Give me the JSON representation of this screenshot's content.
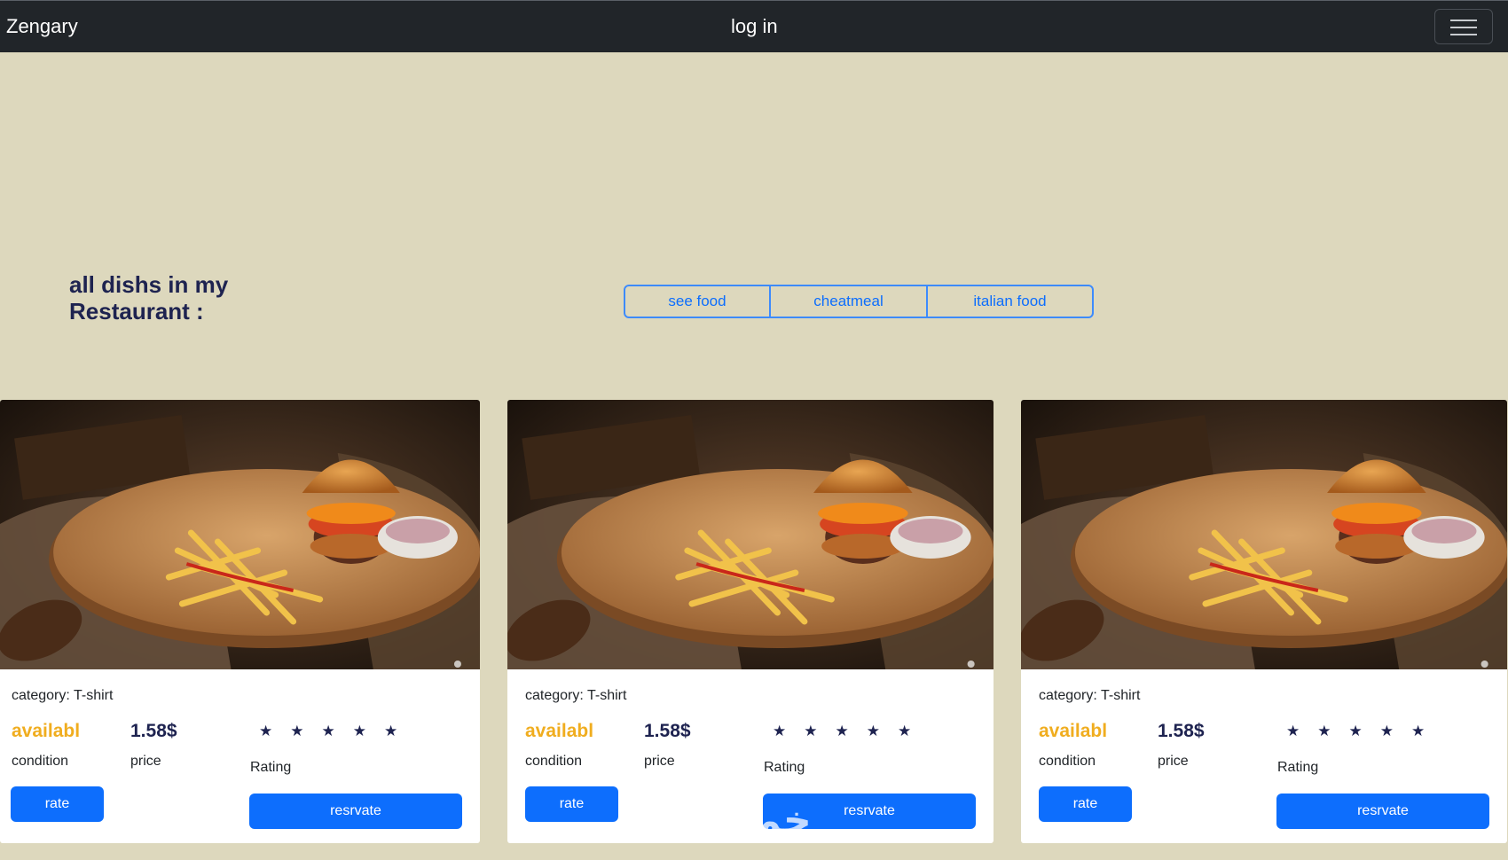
{
  "navbar": {
    "brand": "Zengary",
    "login": "log in",
    "menu_icon": "hamburger-icon"
  },
  "heading": "all dishs in my Restaurant :",
  "filters": [
    "see food",
    "cheatmeal",
    "italian food"
  ],
  "cards": [
    {
      "image": "burger-and-fries-photo",
      "category": "category: T-shirt",
      "availability": "availabl",
      "condition_label": "condition",
      "price": "1.58$",
      "price_label": "price",
      "stars": 5,
      "rating_label": "Rating",
      "rate_label": "rate",
      "reserve_label": "resrvate"
    },
    {
      "image": "burger-and-fries-photo",
      "category": "category: T-shirt",
      "availability": "availabl",
      "condition_label": "condition",
      "price": "1.58$",
      "price_label": "price",
      "stars": 5,
      "rating_label": "Rating",
      "rate_label": "rate",
      "reserve_label": "resrvate"
    },
    {
      "image": "burger-and-fries-photo",
      "category": "category: T-shirt",
      "availability": "availabl",
      "condition_label": "condition",
      "price": "1.58$",
      "price_label": "price",
      "stars": 5,
      "rating_label": "Rating",
      "rate_label": "rate",
      "reserve_label": "resrvate"
    }
  ],
  "watermark": "خمسات",
  "colors": {
    "background": "#ddd8bd",
    "navbar": "#212529",
    "primary": "#0d6efd",
    "available": "#f0ad1f",
    "heading": "#1e2350"
  }
}
